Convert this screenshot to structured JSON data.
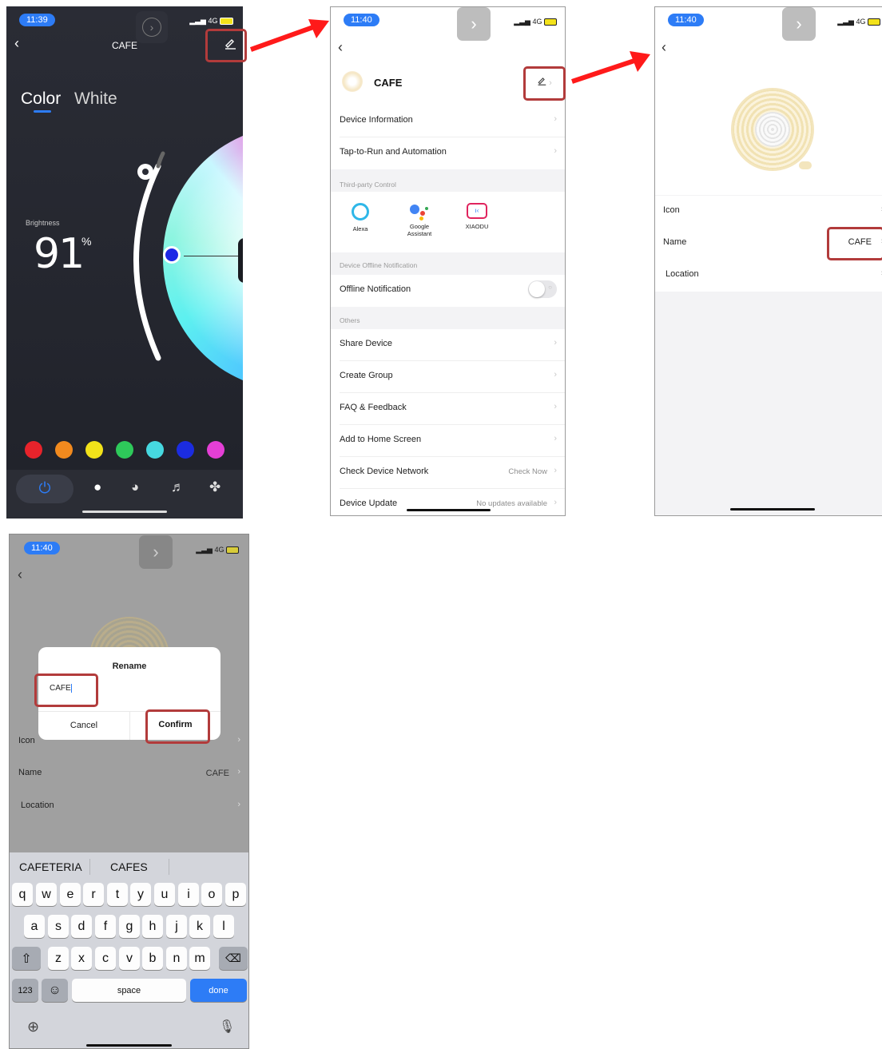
{
  "panel1": {
    "time": "11:39",
    "network": "4G",
    "title": "CAFE",
    "tab_color": "Color",
    "tab_white": "White",
    "brightness_label": "Brightness",
    "brightness_value": "91",
    "brightness_unit": "%",
    "swatch_colors": [
      "#e8232b",
      "#f28a1e",
      "#f2e21a",
      "#2ec95a",
      "#46d8e0",
      "#1b2ce0",
      "#e43fd6"
    ]
  },
  "panel2": {
    "time": "11:40",
    "network": "4G",
    "device_name": "CAFE",
    "rows_top": [
      {
        "label": "Device Information",
        "value": ""
      },
      {
        "label": "Tap-to-Run and Automation",
        "value": ""
      }
    ],
    "section_third_party": "Third-party Control",
    "integrations": [
      {
        "name": "Alexa",
        "icon": "alexa-icon"
      },
      {
        "name": "Google Assistant",
        "icon": "google-assistant-icon"
      },
      {
        "name": "XIAODU",
        "icon": "xiaodu-icon"
      }
    ],
    "section_offline": "Device Offline Notification",
    "offline_label": "Offline Notification",
    "offline_enabled": false,
    "section_others": "Others",
    "rows_others": [
      {
        "label": "Share Device",
        "value": ""
      },
      {
        "label": "Create Group",
        "value": ""
      },
      {
        "label": "FAQ & Feedback",
        "value": ""
      },
      {
        "label": "Add to Home Screen",
        "value": ""
      },
      {
        "label": "Check Device Network",
        "value": "Check Now"
      },
      {
        "label": "Device Update",
        "value": "No updates available"
      }
    ]
  },
  "panel3": {
    "time": "11:40",
    "network": "4G",
    "icon_label": "Icon",
    "name_label": "Name",
    "name_value": "CAFE",
    "location_label": "Location"
  },
  "panel4": {
    "time": "11:40",
    "network": "4G",
    "dialog_title": "Rename",
    "input_value": "CAFE",
    "cancel_label": "Cancel",
    "confirm_label": "Confirm",
    "icon_label": "Icon",
    "name_label": "Name",
    "name_value": "CAFE",
    "location_label": "Location",
    "suggestions": [
      "CAFETERIA",
      "CAFES"
    ],
    "keyboard_rows": [
      [
        "q",
        "w",
        "e",
        "r",
        "t",
        "y",
        "u",
        "i",
        "o",
        "p"
      ],
      [
        "a",
        "s",
        "d",
        "f",
        "g",
        "h",
        "j",
        "k",
        "l"
      ],
      [
        "z",
        "x",
        "c",
        "v",
        "b",
        "n",
        "m"
      ]
    ],
    "key_123": "123",
    "key_space": "space",
    "key_done": "done"
  },
  "colors": {
    "accent_blue": "#2d7cf6",
    "highlight_red": "#b23b3b",
    "arrow_red": "#ff1a1a",
    "dark_panel_bg": "#24262f"
  }
}
